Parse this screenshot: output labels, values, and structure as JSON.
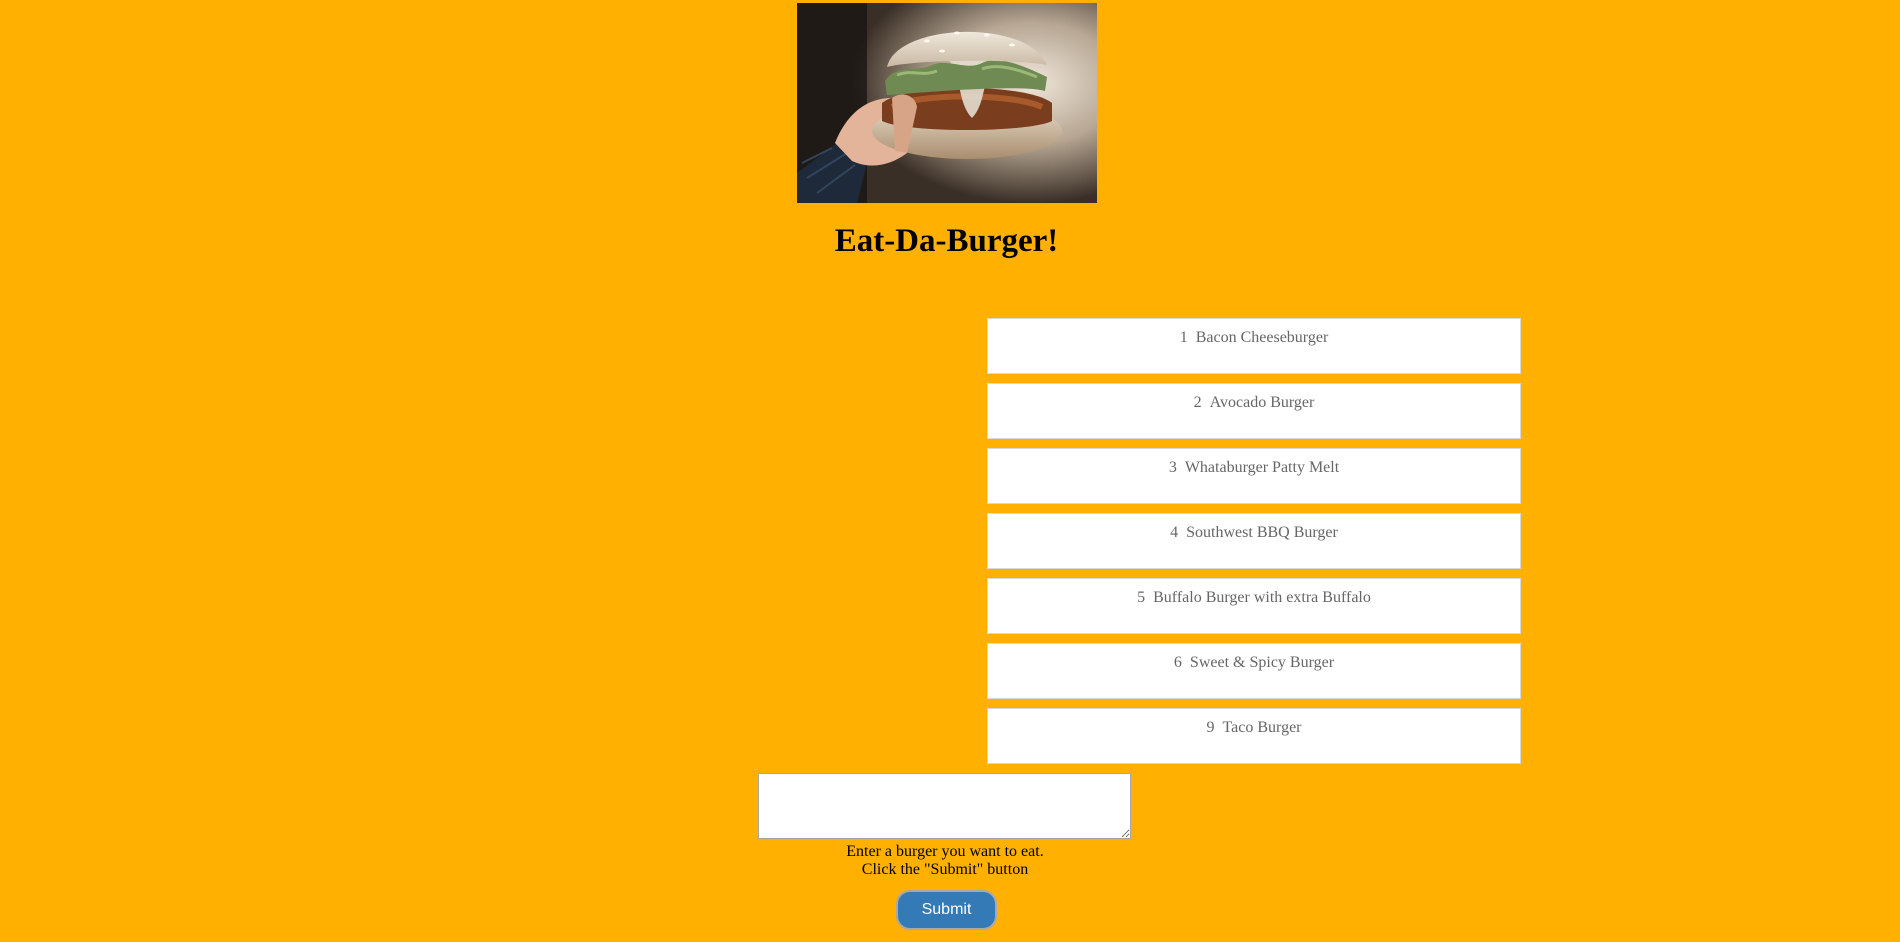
{
  "page": {
    "background_color": "#FFB000",
    "title": "Eat-Da-Burger!"
  },
  "hero_image": {
    "description_icon": "burger-photo"
  },
  "burgers": [
    {
      "id": "1",
      "name": "Bacon Cheeseburger"
    },
    {
      "id": "2",
      "name": "Avocado Burger"
    },
    {
      "id": "3",
      "name": "Whataburger Patty Melt"
    },
    {
      "id": "4",
      "name": "Southwest BBQ Burger"
    },
    {
      "id": "5",
      "name": "Buffalo Burger with extra Buffalo"
    },
    {
      "id": "6",
      "name": "Sweet & Spicy Burger"
    },
    {
      "id": "9",
      "name": "Taco Burger"
    }
  ],
  "form": {
    "input_value": "",
    "instruction_line1": "Enter a burger you want to eat.",
    "instruction_line2": "Click the \"Submit\" button",
    "submit_label": "Submit",
    "submit_color": "#337ab7"
  }
}
